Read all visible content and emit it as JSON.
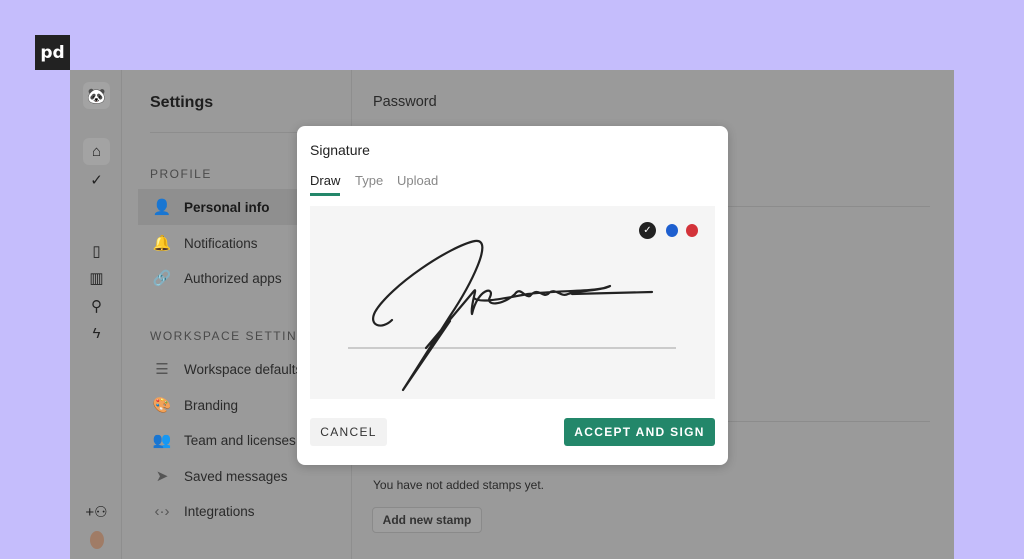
{
  "brand": {
    "logo_text": "pd"
  },
  "rail": {
    "icons": [
      "panda-logo-icon",
      "home-icon",
      "check-circle-icon",
      "document-icon",
      "chart-icon",
      "contact-icon",
      "lightning-icon",
      "add-user-icon",
      "user-avatar"
    ]
  },
  "settings": {
    "title": "Settings",
    "profile_header": "PROFILE",
    "profile_items": [
      {
        "label": "Personal info",
        "icon": "person-icon"
      },
      {
        "label": "Notifications",
        "icon": "bell-icon"
      },
      {
        "label": "Authorized apps",
        "icon": "link-icon"
      }
    ],
    "workspace_header": "WORKSPACE SETTINGS",
    "workspace_items": [
      {
        "label": "Workspace defaults",
        "icon": "sliders-icon"
      },
      {
        "label": "Branding",
        "icon": "palette-icon"
      },
      {
        "label": "Team and licenses",
        "icon": "people-icon"
      },
      {
        "label": "Saved messages",
        "icon": "send-icon"
      },
      {
        "label": "Integrations",
        "icon": "code-icon"
      }
    ]
  },
  "main": {
    "password_label": "Password",
    "stamps_empty": "You have not added stamps yet.",
    "add_stamp": "Add new stamp"
  },
  "modal": {
    "title": "Signature",
    "tabs": [
      {
        "label": "Draw",
        "active": true
      },
      {
        "label": "Type"
      },
      {
        "label": "Upload"
      }
    ],
    "ink_colors": [
      {
        "color": "#222222",
        "selected": true
      },
      {
        "color": "#1e5fcf"
      },
      {
        "color": "#d3333a"
      }
    ],
    "cancel": "CANCEL",
    "accept": "ACCEPT AND SIGN",
    "accent": "#23876a"
  }
}
